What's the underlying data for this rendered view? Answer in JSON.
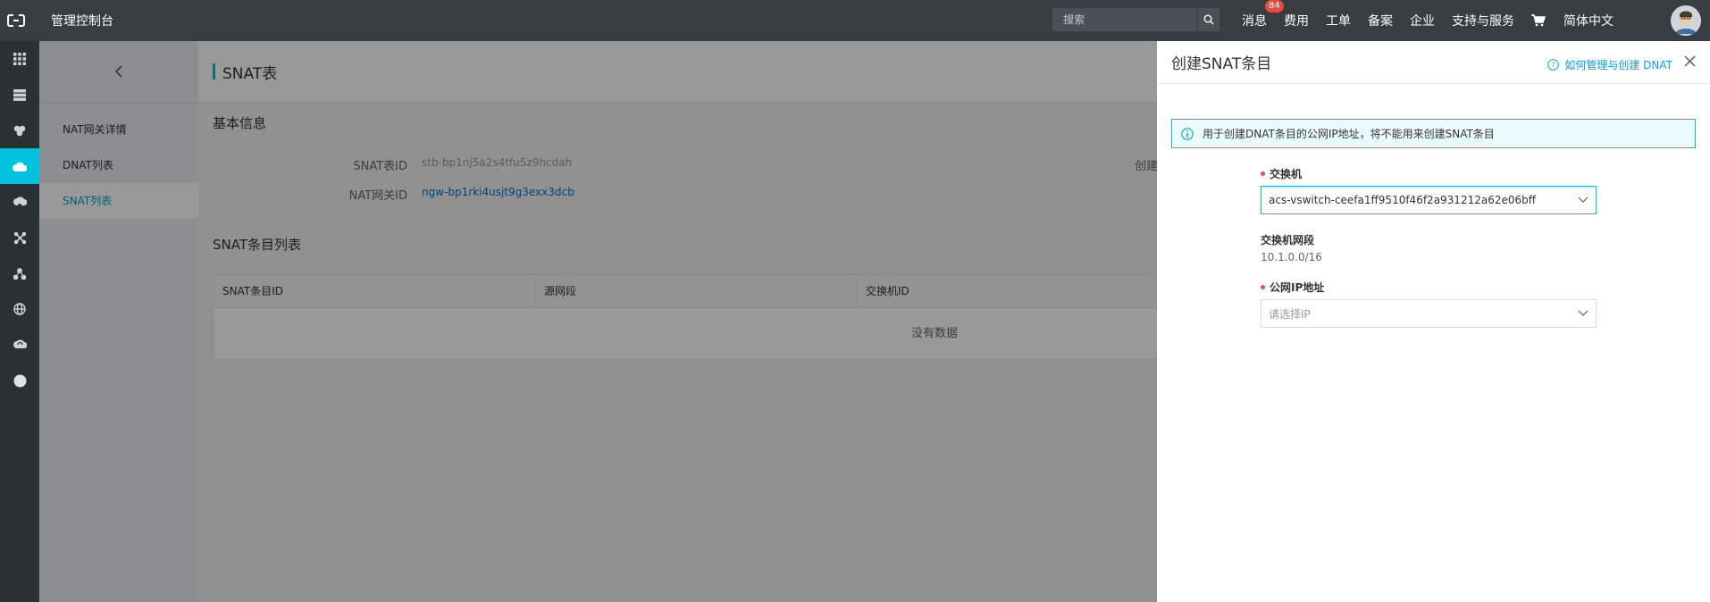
{
  "topbar": {
    "brand": "管理控制台",
    "search_placeholder": "搜索",
    "nav": [
      "消息",
      "费用",
      "工单",
      "备案",
      "企业",
      "支持与服务",
      "简体中文"
    ],
    "message_badge": "84"
  },
  "rail_icons": [
    "grid-icon",
    "server-icon",
    "cluster-icon",
    "cloud-icon",
    "cloud-gear-icon",
    "network-icon",
    "nodes-icon",
    "globe-icon",
    "cloud-sync-icon",
    "circle-icon"
  ],
  "subnav": {
    "items": [
      "NAT网关详情",
      "DNAT列表",
      "SNAT列表"
    ],
    "active_index": 2
  },
  "main": {
    "title": "SNAT表",
    "basic_info_title": "基本信息",
    "snat_id_label": "SNAT表ID",
    "snat_id_value": "stb-bp1nj5a2s4tfu5z9hcdah",
    "nat_id_label": "NAT网关ID",
    "nat_id_value": "ngw-bp1rki4usjt9g3exx3dcb",
    "truncated_label": "创建",
    "list_title": "SNAT条目列表",
    "columns": [
      "SNAT条目ID",
      "源网段",
      "交换机ID"
    ],
    "empty_text": "没有数据"
  },
  "drawer": {
    "title": "创建SNAT条目",
    "help_link": "如何管理与创建 DNAT",
    "alert": "用于创建DNAT条目的公网IP地址，将不能用来创建SNAT条目",
    "switch_label": "交换机",
    "switch_value": "acs-vswitch-ceefa1ff9510f46f2a931212a62e06bff",
    "cidr_label": "交换机网段",
    "cidr_value": "10.1.0.0/16",
    "ip_label": "公网IP地址",
    "ip_placeholder": "请选择IP"
  },
  "colors": {
    "topbar": "#373d41",
    "accent": "#00c1de",
    "link": "#0070cc"
  }
}
